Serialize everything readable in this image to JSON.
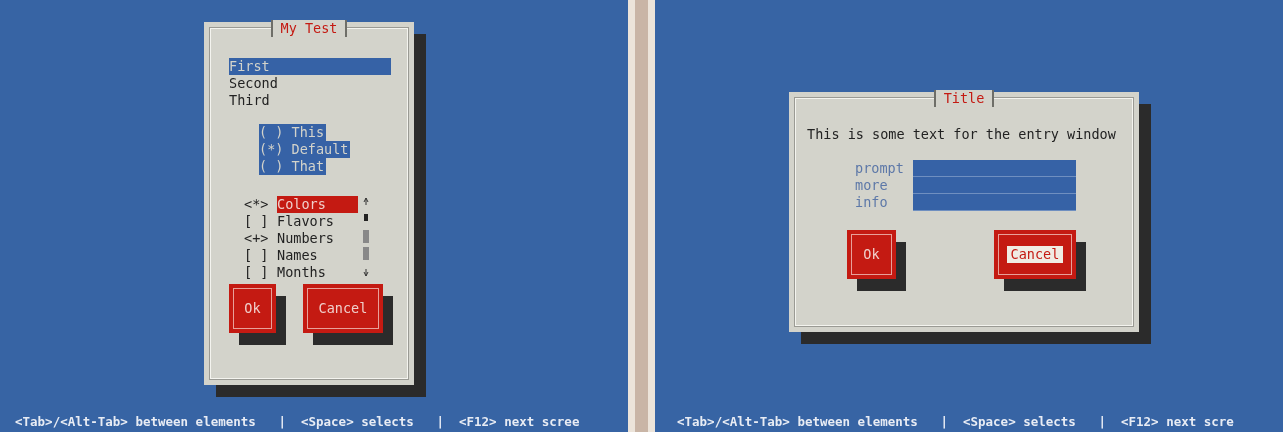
{
  "panes": [
    {
      "kind": "checklist",
      "dialog": {
        "title": "My Test",
        "listbox": [
          {
            "label": "First",
            "selected": true
          },
          {
            "label": "Second",
            "selected": false
          },
          {
            "label": "Third",
            "selected": false
          }
        ],
        "radios": [
          {
            "label": "( ) This"
          },
          {
            "label": "(*) Default"
          },
          {
            "label": "( ) That"
          }
        ],
        "tree": [
          {
            "marker": "<*>",
            "label": "Colors",
            "selected": true
          },
          {
            "marker": "[ ]",
            "label": "Flavors",
            "selected": false
          },
          {
            "marker": "<+>",
            "label": "Numbers",
            "selected": false
          },
          {
            "marker": "[ ]",
            "label": "Names",
            "selected": false
          },
          {
            "marker": "[ ]",
            "label": "Months",
            "selected": false
          }
        ],
        "buttons": [
          {
            "label": "Ok",
            "focused": false
          },
          {
            "label": "Cancel",
            "focused": false
          }
        ]
      },
      "status": "<Tab>/<Alt-Tab> between elements   |  <Space> selects   |  <F12> next scree"
    },
    {
      "kind": "entry",
      "dialog": {
        "title": "Title",
        "text": "This is some text for the entry window",
        "fields": [
          {
            "label": "prompt"
          },
          {
            "label": "more"
          },
          {
            "label": "info"
          }
        ],
        "buttons": [
          {
            "label": "Ok",
            "focused": false
          },
          {
            "label": "Cancel",
            "focused": true
          }
        ]
      },
      "status": "<Tab>/<Alt-Tab> between elements   |  <Space> selects   |  <F12> next scre"
    }
  ]
}
